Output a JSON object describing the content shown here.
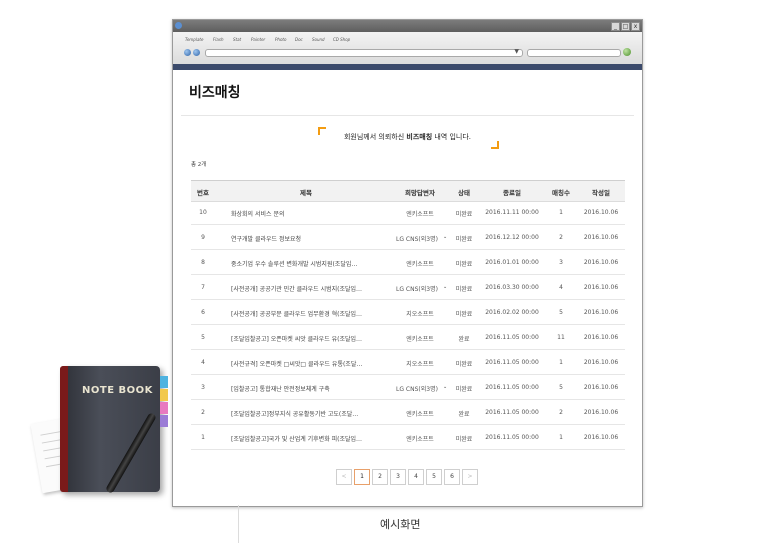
{
  "page": {
    "title": "비즈매칭",
    "intro_pre": "회원님께서 의뢰하신 ",
    "intro_bold": "비즈매칭",
    "intro_post": " 내역 입니다.",
    "total": "총 2개",
    "caption": "예시화면"
  },
  "browser": {
    "menu": [
      "Template",
      "Flash",
      "Stat",
      "Painter",
      "Photo",
      "Doc",
      "Sound",
      "CD Shop"
    ],
    "window_buttons": [
      "_",
      "□",
      "x"
    ]
  },
  "table": {
    "headers": [
      "번호",
      "제목",
      "희망답변자",
      "상태",
      "종료일",
      "매칭수",
      "작성일"
    ],
    "rows": [
      {
        "no": "10",
        "title": "화상회의 서비스 문의",
        "responder": "엔키소프트",
        "dropdown": false,
        "status": "미완료",
        "end": "2016.11.11 00:00",
        "count": "1",
        "date": "2016.10.06"
      },
      {
        "no": "9",
        "title": "연구개발 클라우드 정보요청",
        "responder": "LG CNS(외3명)",
        "dropdown": true,
        "status": "미완료",
        "end": "2016.12.12 00:00",
        "count": "2",
        "date": "2016.10.06"
      },
      {
        "no": "8",
        "title": "중소기업 우수 솔루션 변화개발 시범지원(조달입…",
        "responder": "엔키소프트",
        "dropdown": false,
        "status": "미완료",
        "end": "2016.01.01 00:00",
        "count": "3",
        "date": "2016.10.06"
      },
      {
        "no": "7",
        "title": "[사전공개] 공공기관 민간 클라우드 시범지(조달입…",
        "responder": "LG CNS(외3명)",
        "dropdown": true,
        "status": "미완료",
        "end": "2016.03.30 00:00",
        "count": "4",
        "date": "2016.10.06"
      },
      {
        "no": "6",
        "title": "[사전공개] 공공부문 클라우드 업무환경 혁(조달입…",
        "responder": "지오소프트",
        "dropdown": false,
        "status": "미완료",
        "end": "2016.02.02 00:00",
        "count": "5",
        "date": "2016.10.06"
      },
      {
        "no": "5",
        "title": "[조달입찰공고] 오픈마켓 씨앗 클라우드 유(조달입…",
        "responder": "엔키소프트",
        "dropdown": false,
        "status": "완료",
        "end": "2016.11.05 00:00",
        "count": "11",
        "date": "2016.10.06"
      },
      {
        "no": "4",
        "title": "[사전규격] 오픈마켓 □씨앗□ 클라우드 유통(조달…",
        "responder": "지오소프트",
        "dropdown": false,
        "status": "미완료",
        "end": "2016.11.05 00:00",
        "count": "1",
        "date": "2016.10.06"
      },
      {
        "no": "3",
        "title": "[입찰공고] 통합재난 안전정보체계 구축",
        "responder": "LG CNS(외3명)",
        "dropdown": true,
        "status": "미완료",
        "end": "2016.11.05 00:00",
        "count": "5",
        "date": "2016.10.06"
      },
      {
        "no": "2",
        "title": "[조달입찰공고]정부지식 공유활동기반 고도(조달…",
        "responder": "엔키소프트",
        "dropdown": false,
        "status": "완료",
        "end": "2016.11.05 00:00",
        "count": "2",
        "date": "2016.10.06"
      },
      {
        "no": "1",
        "title": "[조달입찰공고]국가 및 산업계 기후변화 피(조달입…",
        "responder": "엔키소프트",
        "dropdown": false,
        "status": "미완료",
        "end": "2016.11.05 00:00",
        "count": "1",
        "date": "2016.10.06"
      }
    ]
  },
  "pagination": {
    "prev": "<",
    "pages": [
      "1",
      "2",
      "3",
      "4",
      "5",
      "6"
    ],
    "current": "1",
    "next": ">"
  },
  "decoration": {
    "notebook_label": "NOTE BOOK"
  }
}
